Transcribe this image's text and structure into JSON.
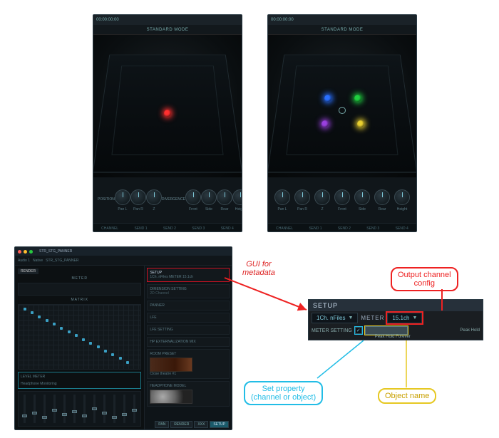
{
  "panner": {
    "header_text": "00:00:00:00",
    "mode_label": "STANDARD MODE",
    "section_position": "POSITION",
    "section_divergence": "DIVERGENCE",
    "knob_labels": [
      "Pan L",
      "Pan R",
      "Z",
      "Front",
      "Side",
      "Rear",
      "Height"
    ],
    "single_orb_color": "#ff3030",
    "multi_orb_colors": {
      "left_front": "#2a70ff",
      "right_front": "#20d040",
      "left_rear": "#9a40e0",
      "right_rear": "#e8d030"
    },
    "bottombar_labels": [
      "CHANNEL",
      "SEND 1",
      "SEND 2",
      "SEND 3",
      "SEND 4"
    ]
  },
  "host": {
    "window_title": "STR_STG_PANNER",
    "toolbar": {
      "audio": "Audio 1",
      "native": "Native",
      "plugin": "STR_STG_PANNER"
    },
    "tabs": {
      "render": "RENDER"
    },
    "section_meter": "METER",
    "section_matrix": "MATRIX",
    "level_meter_title": "LEVEL METER",
    "level_meter_sub": "Headphone Monitoring",
    "right_panels": {
      "setup": "SETUP",
      "setup_content": "1Ch. nFiles   METER   15.1ch",
      "dimension": "DIMENSION SETTING",
      "dimension_sub": "2D Channel",
      "panner": "PANNER",
      "lfe": "LFE",
      "lfe_setting": "LFE SETTING",
      "room": "ROOM PRESET",
      "room_preset": "Close theatre #1",
      "hp": "HEADPHONE MODEL",
      "externalization": "HP EXTERNALIZATION MIX"
    },
    "bottom_buttons": [
      "PAN",
      "RENDER",
      "XXX",
      "SETUP"
    ]
  },
  "setup_zoom": {
    "title": "SETUP",
    "input_mode": "1Ch. nFiles",
    "meter_label": "METER",
    "output_config": "15.1ch",
    "row2_label": "METER SETTING",
    "peak_hold_forever": "Peak Hold Forever",
    "peak_hold": "Peak Hold",
    "object_name_value": ""
  },
  "annotations": {
    "gui_for_metadata": "GUI for\nmetadata",
    "output_channel": "Output channel\nconfig",
    "set_property": "Set property\n(channel or object)",
    "object_name": "Object name"
  }
}
